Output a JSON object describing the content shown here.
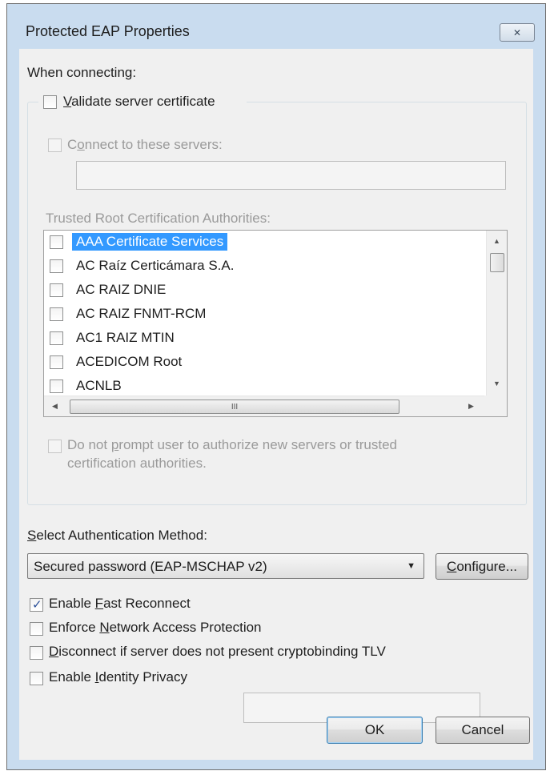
{
  "window": {
    "title": "Protected EAP Properties",
    "close_glyph": "✕"
  },
  "connecting": {
    "heading": "When connecting:",
    "validate_cert": {
      "label": "Validate server certificate",
      "checked": false
    },
    "connect_servers": {
      "label": "Connect to these servers:",
      "checked": false,
      "value": ""
    },
    "trusted_root_label": "Trusted Root Certification Authorities:",
    "cas": [
      {
        "label": "AAA Certificate Services",
        "checked": false,
        "selected": true
      },
      {
        "label": "AC Raíz Certicámara S.A.",
        "checked": false,
        "selected": false
      },
      {
        "label": "AC RAIZ DNIE",
        "checked": false,
        "selected": false
      },
      {
        "label": "AC RAIZ FNMT-RCM",
        "checked": false,
        "selected": false
      },
      {
        "label": "AC1 RAIZ MTIN",
        "checked": false,
        "selected": false
      },
      {
        "label": "ACEDICOM Root",
        "checked": false,
        "selected": false
      },
      {
        "label": "ACNLB",
        "checked": false,
        "selected": false
      }
    ],
    "do_not_prompt": {
      "line1": "Do not prompt user to authorize new servers or trusted",
      "line2": "certification authorities.",
      "checked": false
    }
  },
  "auth": {
    "label": "Select Authentication Method:",
    "method": "Secured password (EAP-MSCHAP v2)",
    "configure_label": "Configure..."
  },
  "options": {
    "fast_reconnect": {
      "label": "Enable Fast Reconnect",
      "checked": true
    },
    "nap": {
      "label": "Enforce Network Access Protection",
      "checked": false
    },
    "cryptobinding": {
      "label": "Disconnect if server does not present cryptobinding TLV",
      "checked": false
    },
    "identity_privacy": {
      "label": "Enable Identity Privacy",
      "checked": false,
      "value": ""
    }
  },
  "buttons": {
    "ok": "OK",
    "cancel": "Cancel"
  },
  "scroll_glyphs": {
    "up": "▲",
    "down": "▼",
    "left": "◀",
    "right": "▶",
    "grip": "III"
  },
  "check_glyph": "✓"
}
